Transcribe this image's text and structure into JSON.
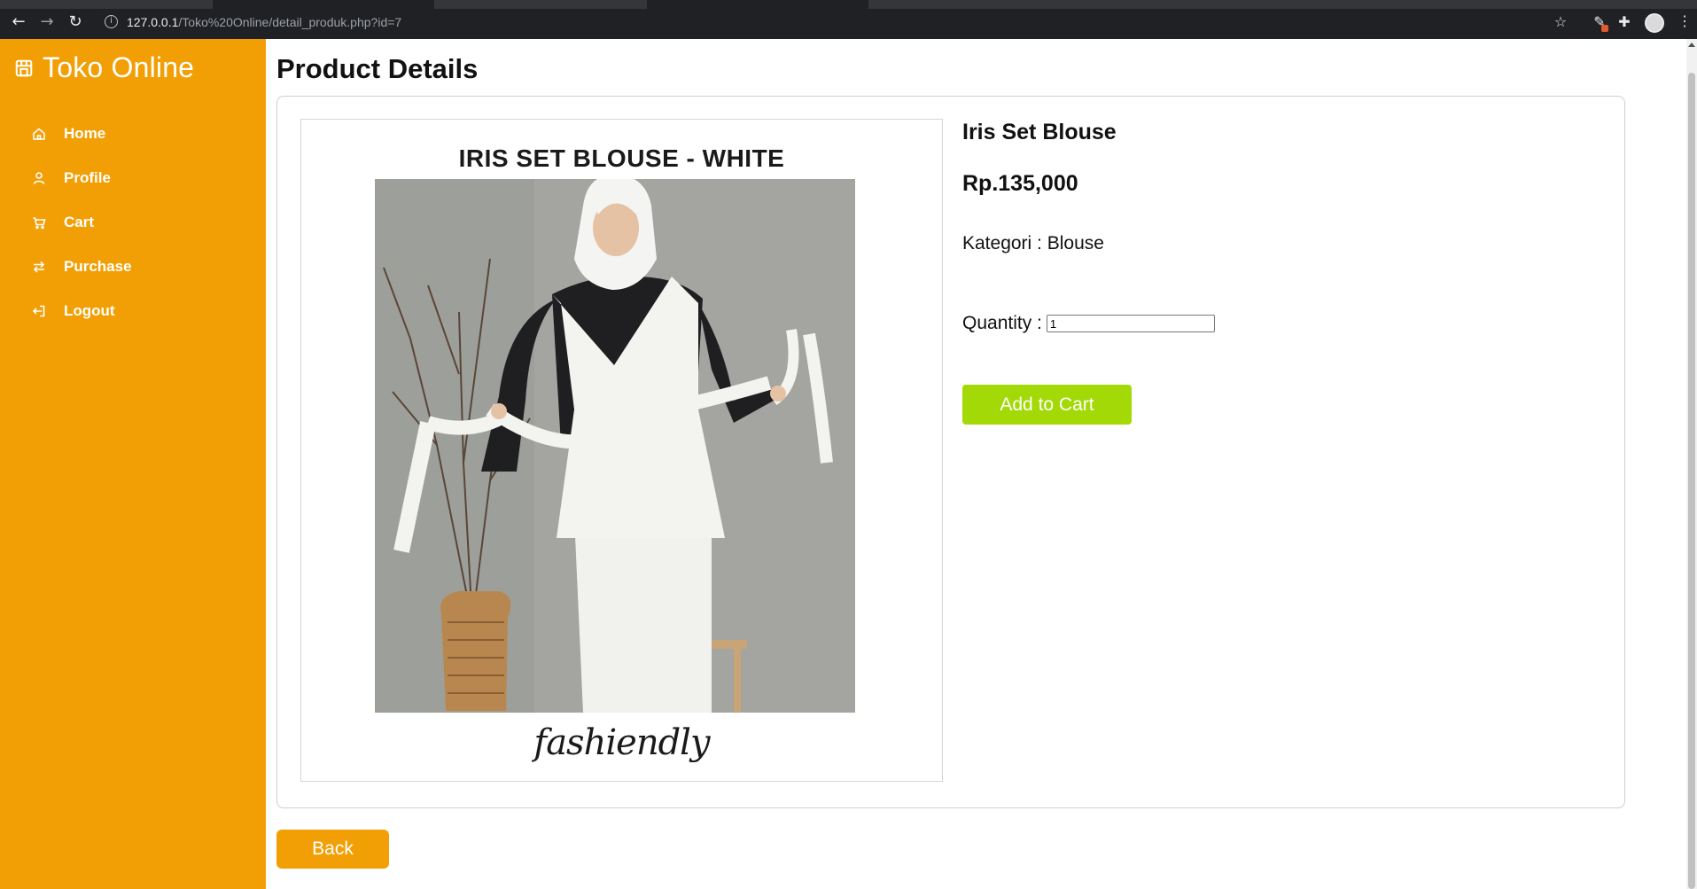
{
  "browser": {
    "url_host": "127.0.0.1",
    "url_path": "/Toko%20Online/detail_produk.php?id=7"
  },
  "sidebar": {
    "brand": "Toko Online",
    "items": [
      {
        "label": "Home",
        "icon": "home-icon"
      },
      {
        "label": "Profile",
        "icon": "user-icon"
      },
      {
        "label": "Cart",
        "icon": "cart-icon"
      },
      {
        "label": "Purchase",
        "icon": "swap-icon"
      },
      {
        "label": "Logout",
        "icon": "logout-icon"
      }
    ]
  },
  "main": {
    "title": "Product Details"
  },
  "product": {
    "image_title": "IRIS SET BLOUSE - WHITE",
    "image_signature": "fashiendly",
    "name": "Iris Set Blouse",
    "price": "Rp.135,000",
    "category_text": "Kategori : Blouse",
    "quantity_label": "Quantity :",
    "quantity_value": "1",
    "add_to_cart_label": "Add to Cart"
  },
  "actions": {
    "back_label": "Back"
  },
  "colors": {
    "sidebar_bg": "#f29f05",
    "add_cart_bg": "#a3d907",
    "back_bg": "#f29f05"
  }
}
